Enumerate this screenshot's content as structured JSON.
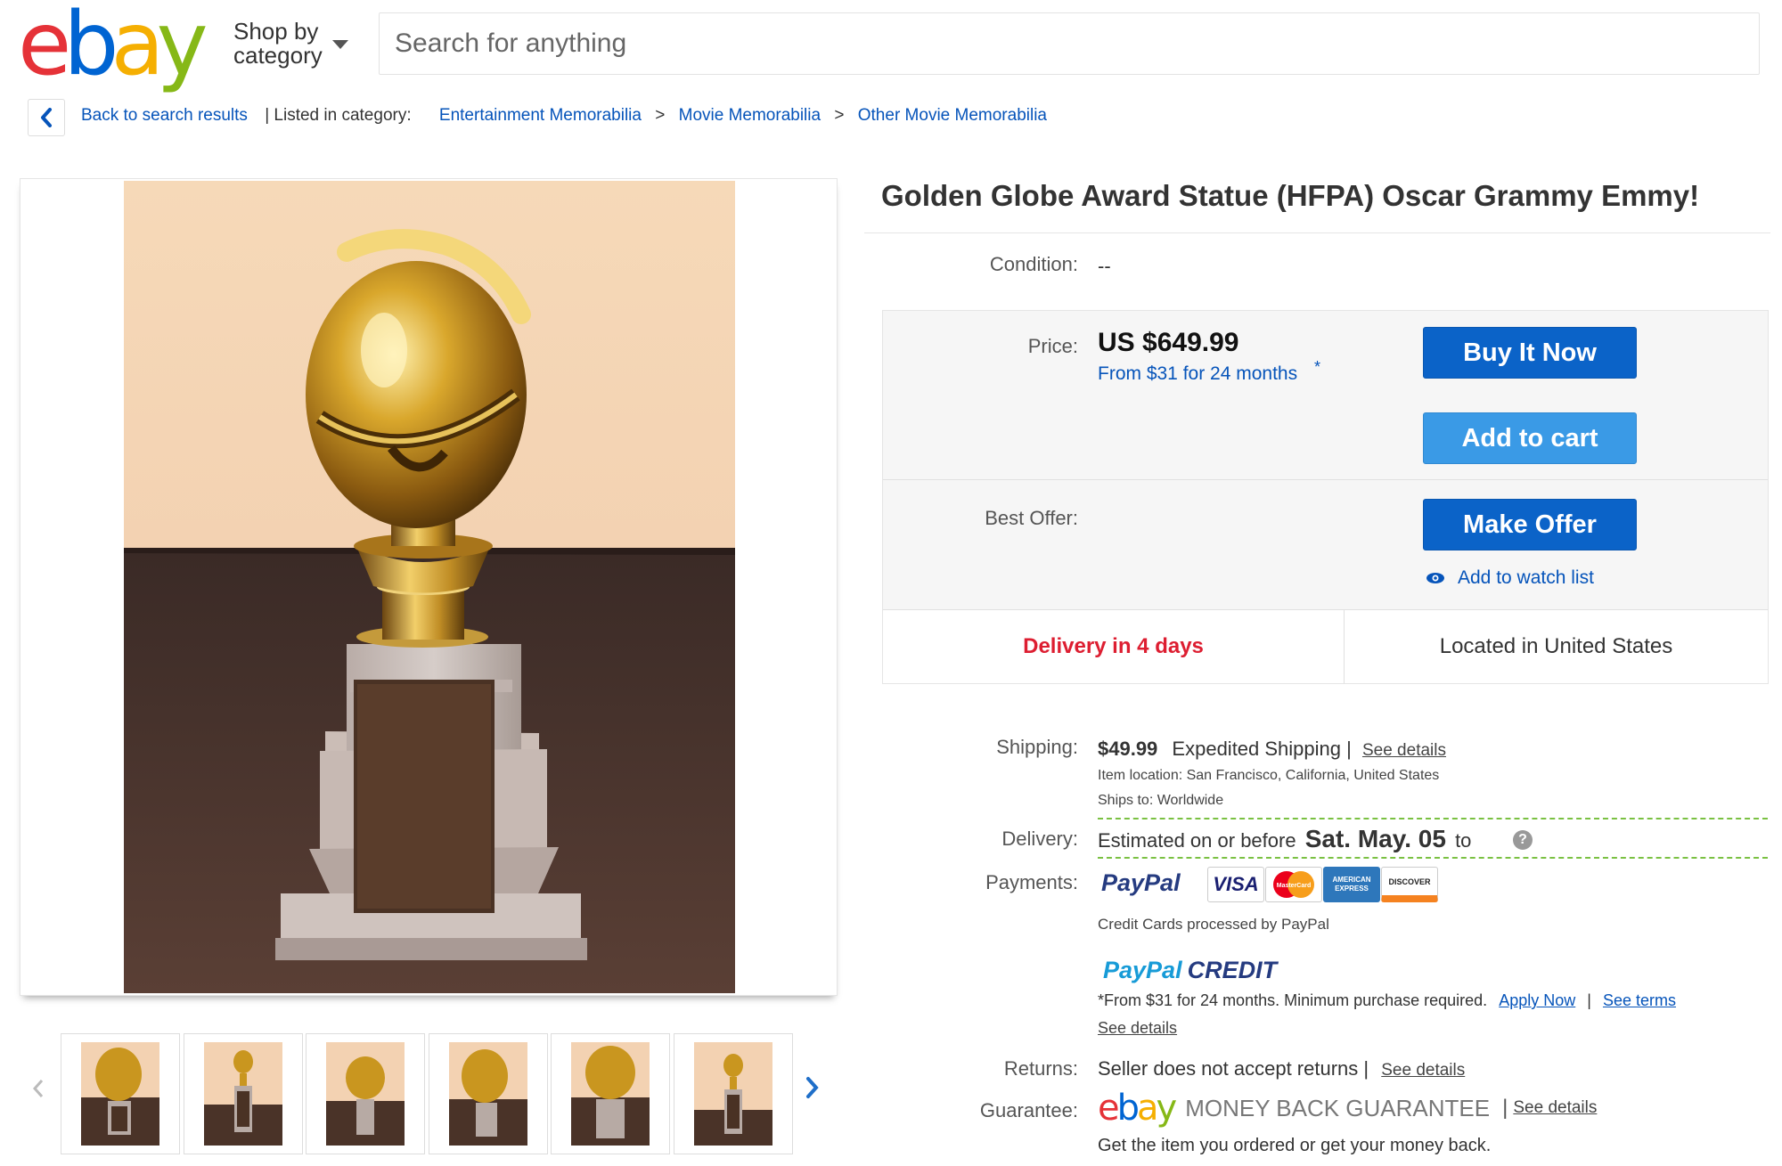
{
  "header": {
    "logo_letters": [
      "e",
      "b",
      "a",
      "y"
    ],
    "logo_colors": [
      "#e53238",
      "#0064d2",
      "#f5af02",
      "#86b817"
    ],
    "shop_by_line1": "Shop by",
    "shop_by_line2": "category",
    "search_placeholder": "Search for anything"
  },
  "breadcrumb": {
    "back_label": "Back to search results",
    "listed_in_label": "| Listed in category:",
    "categories": [
      "Entertainment Memorabilia",
      "Movie Memorabilia",
      "Other Movie Memorabilia"
    ],
    "separator": ">"
  },
  "listing": {
    "title": "Golden Globe Award Statue (HFPA) Oscar Grammy Emmy!",
    "condition_label": "Condition:",
    "condition_value": "--",
    "price_label": "Price:",
    "price_value": "US $649.99",
    "finance_text": "From $31 for 24 months",
    "finance_mark": "*",
    "buy_now_label": "Buy It Now",
    "add_to_cart_label": "Add to cart",
    "best_offer_label": "Best Offer:",
    "make_offer_label": "Make Offer",
    "watch_label": "Add to watch list",
    "delivery_days": "Delivery in 4 days",
    "located": "Located in United States"
  },
  "shipping": {
    "label": "Shipping:",
    "cost": "$49.99",
    "method": "Expedited Shipping |",
    "see_details": "See details",
    "item_location": "Item location:  San Francisco, California, United States",
    "ships_to": "Ships to:  Worldwide"
  },
  "delivery": {
    "label": "Delivery:",
    "prefix": "Estimated on or before",
    "date": "Sat. May. 05",
    "suffix": "to"
  },
  "payments": {
    "label": "Payments:",
    "paypal": "PayPal",
    "cards": [
      "VISA",
      "MasterCard",
      "AMERICAN EXPRESS",
      "DISCOVER"
    ],
    "processed_note": "Credit Cards processed by PayPal",
    "paypal_credit_word1": "PayPal",
    "paypal_credit_word2": "CREDIT",
    "credit_note": "*From $31 for 24 months. Minimum purchase required.",
    "apply_now": "Apply Now",
    "see_terms": "See terms",
    "see_details": "See details"
  },
  "returns": {
    "label": "Returns:",
    "value": "Seller does not accept returns |",
    "see_details": "See details"
  },
  "guarantee": {
    "label": "Guarantee:",
    "money_back": "MONEY BACK GUARANTEE",
    "see_details": "See details",
    "note": "Get the item you ordered or get your money back."
  },
  "colors": {
    "link": "#0654ba",
    "buy_button": "#0b63c8",
    "cart_button": "#3a9ae6",
    "delivery_red": "#dd1e31",
    "dash_green": "#7ac142"
  }
}
